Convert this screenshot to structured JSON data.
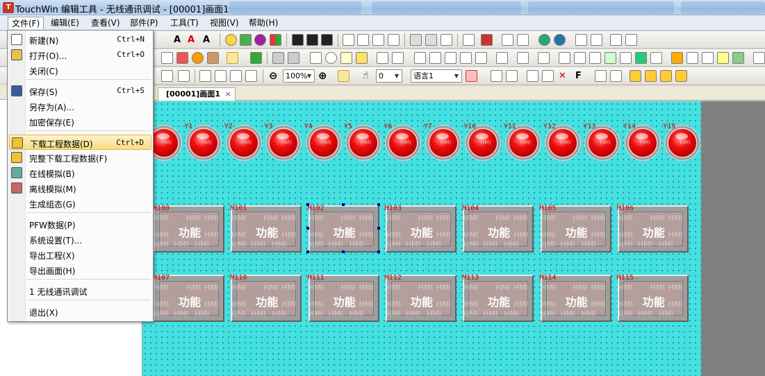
{
  "window": {
    "title": "TouchWin 编辑工具 - 无线通讯调试 - [00001]画面1",
    "app_icon_letter": "T"
  },
  "menubar": {
    "items": [
      "文件(F)",
      "编辑(E)",
      "查看(V)",
      "部件(P)",
      "工具(T)",
      "视图(V)",
      "帮助(H)"
    ],
    "active": "文件(F)"
  },
  "toolbar": {
    "zoom": "100%",
    "layer": "0",
    "language": "语言1"
  },
  "document": {
    "tab_label": "[00001]画面1",
    "tab_close": "×"
  },
  "file_menu": {
    "items": [
      {
        "label": "新建(N)",
        "shortcut": "Ctrl+N",
        "icon": "new-file-icon"
      },
      {
        "label": "打开(O)...",
        "shortcut": "Ctrl+O",
        "icon": "open-folder-icon"
      },
      {
        "label": "关闭(C)",
        "shortcut": "",
        "icon": ""
      },
      {
        "label": "保存(S)",
        "shortcut": "Ctrl+S",
        "icon": "save-disk-icon"
      },
      {
        "label": "另存为(A)...",
        "shortcut": "",
        "icon": ""
      },
      {
        "label": "加密保存(E)",
        "shortcut": "",
        "icon": ""
      },
      {
        "label": "下载工程数据(D)",
        "shortcut": "Ctrl+D",
        "icon": "download-icon"
      },
      {
        "label": "完整下载工程数据(F)",
        "shortcut": "",
        "icon": "full-download-icon"
      },
      {
        "label": "在线模拟(B)",
        "shortcut": "",
        "icon": "online-sim-icon"
      },
      {
        "label": "离线模拟(M)",
        "shortcut": "",
        "icon": "offline-sim-icon"
      },
      {
        "label": "生成组态(G)",
        "shortcut": "",
        "icon": ""
      },
      {
        "label": "PFW数据(P)",
        "shortcut": "",
        "icon": ""
      },
      {
        "label": "系统设置(T)...",
        "shortcut": "",
        "icon": ""
      },
      {
        "label": "导出工程(X)",
        "shortcut": "",
        "icon": ""
      },
      {
        "label": "导出画面(H)",
        "shortcut": "",
        "icon": ""
      },
      {
        "label": "1 无线通讯调试",
        "shortcut": "",
        "icon": ""
      },
      {
        "label": "退出(X)",
        "shortcut": "",
        "icon": ""
      }
    ],
    "highlighted_index": 6
  },
  "screen": {
    "lamps": [
      "",
      "Y1",
      "Y2",
      "Y3",
      "Y4",
      "Y5",
      "Y6",
      "Y7",
      "Y10",
      "Y11",
      "Y12",
      "Y13",
      "Y14",
      "Y15"
    ],
    "lamp_watermark": "HMI",
    "button_text": "功能",
    "button_watermark": "HMI",
    "buttons_row1": [
      "M100",
      "M101",
      "M102",
      "M103",
      "M104",
      "M105",
      "M106"
    ],
    "buttons_row2": [
      "M107",
      "M110",
      "M111",
      "M112",
      "M113",
      "M114",
      "M115"
    ],
    "selected_button": "M102"
  },
  "colors": {
    "canvas_bg": "#43e1e1",
    "lamp_red": "#f01010",
    "label_red": "#cc0000",
    "button_face": "#b49e9c",
    "menu_highlight": "#f8dc80"
  }
}
